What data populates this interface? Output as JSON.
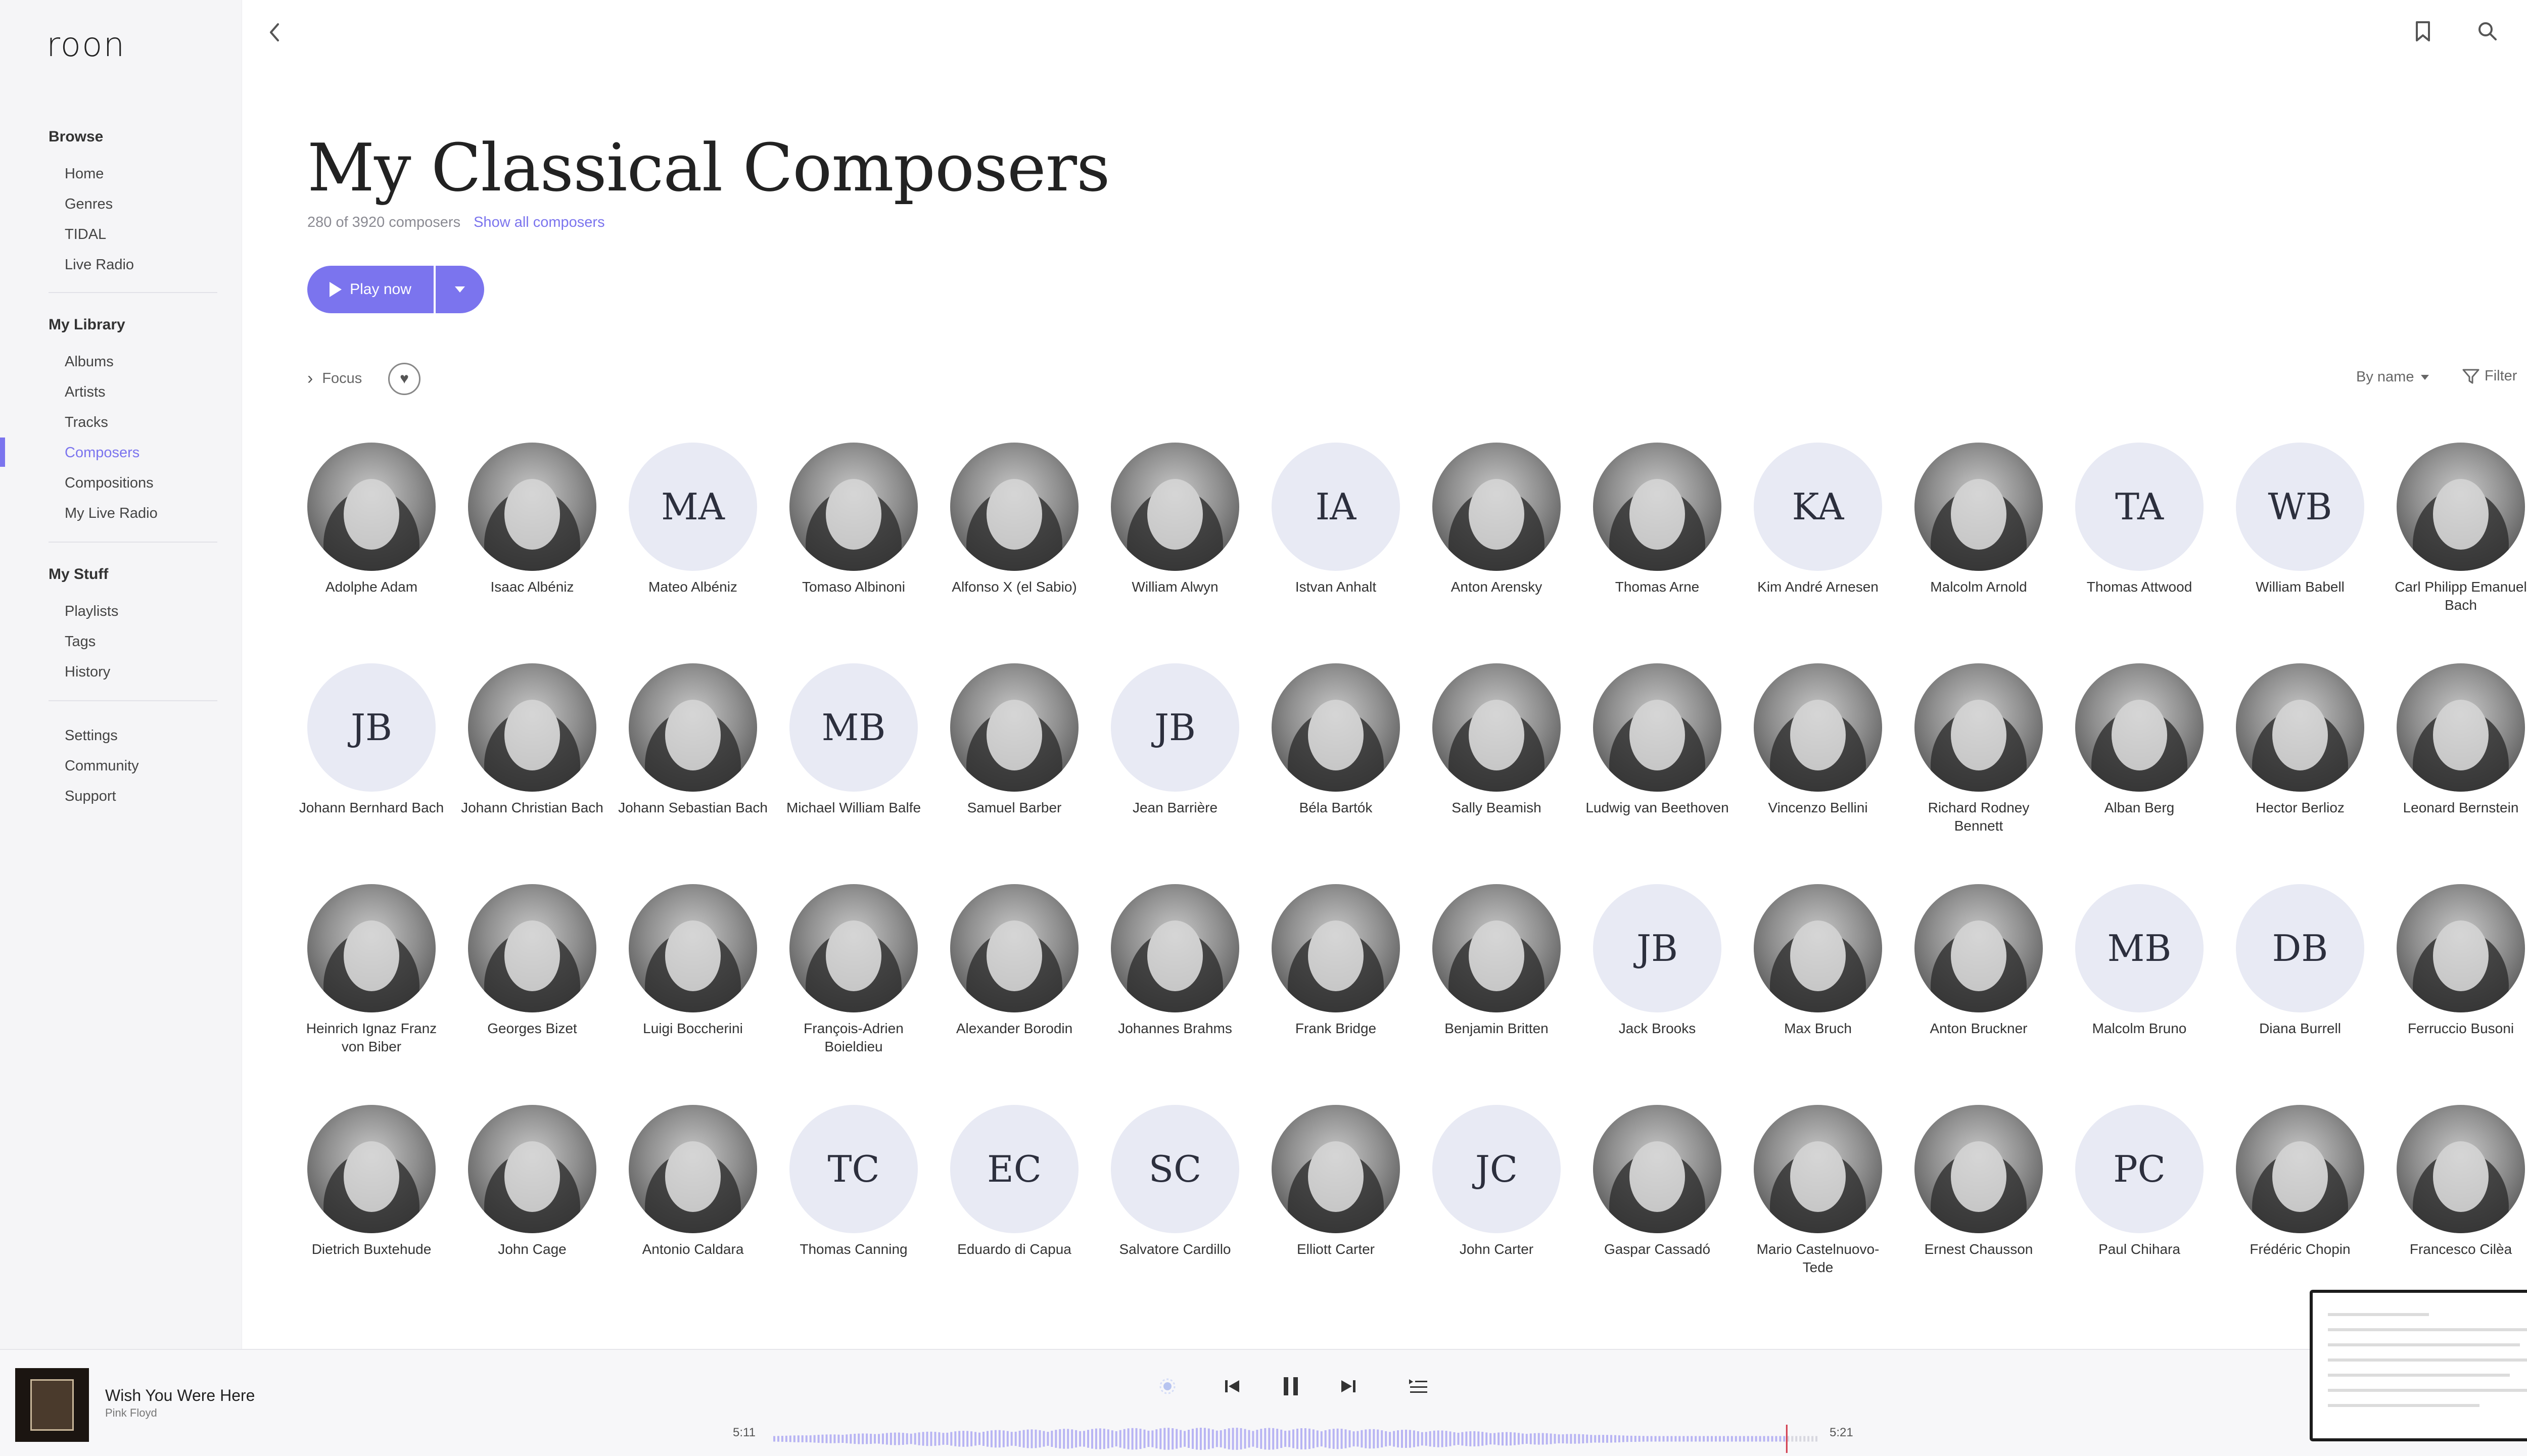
{
  "app": {
    "logo": "roon",
    "accent": "#7b74ee"
  },
  "sidebar": {
    "browse": {
      "heading": "Browse",
      "items": [
        "Home",
        "Genres",
        "TIDAL",
        "Live Radio"
      ]
    },
    "library": {
      "heading": "My Library",
      "items": [
        "Albums",
        "Artists",
        "Tracks",
        "Composers",
        "Compositions",
        "My Live Radio"
      ],
      "active": "Composers"
    },
    "stuff": {
      "heading": "My Stuff",
      "items": [
        "Playlists",
        "Tags",
        "History"
      ]
    },
    "misc": {
      "items": [
        "Settings",
        "Community",
        "Support"
      ]
    }
  },
  "topbar": {
    "icons": [
      "back-icon",
      "bookmark-icon",
      "search-icon",
      "profile-avatar"
    ]
  },
  "main": {
    "title": "My Classical Composers",
    "count_text": "280 of 3920 composers",
    "show_all": "Show all composers",
    "play_now": "Play now",
    "focus": "Focus",
    "sort": "By name",
    "filter": "Filter"
  },
  "composers": [
    {
      "name": "Adolphe Adam",
      "initials": ""
    },
    {
      "name": "Isaac Albéniz",
      "initials": ""
    },
    {
      "name": "Mateo Albéniz",
      "initials": "MA"
    },
    {
      "name": "Tomaso Albinoni",
      "initials": ""
    },
    {
      "name": "Alfonso X (el Sabio)",
      "initials": ""
    },
    {
      "name": "William Alwyn",
      "initials": ""
    },
    {
      "name": "Istvan Anhalt",
      "initials": "IA"
    },
    {
      "name": "Anton Arensky",
      "initials": ""
    },
    {
      "name": "Thomas Arne",
      "initials": ""
    },
    {
      "name": "Kim André Arnesen",
      "initials": "KA"
    },
    {
      "name": "Malcolm Arnold",
      "initials": ""
    },
    {
      "name": "Thomas Attwood",
      "initials": "TA"
    },
    {
      "name": "William Babell",
      "initials": "WB"
    },
    {
      "name": "Carl Philipp Emanuel Bach",
      "initials": ""
    },
    {
      "name": "Johann Bernhard Bach",
      "initials": "JB"
    },
    {
      "name": "Johann Christian Bach",
      "initials": ""
    },
    {
      "name": "Johann Sebastian Bach",
      "initials": ""
    },
    {
      "name": "Michael William Balfe",
      "initials": "MB"
    },
    {
      "name": "Samuel Barber",
      "initials": ""
    },
    {
      "name": "Jean Barrière",
      "initials": "JB"
    },
    {
      "name": "Béla Bartók",
      "initials": ""
    },
    {
      "name": "Sally Beamish",
      "initials": ""
    },
    {
      "name": "Ludwig van Beethoven",
      "initials": ""
    },
    {
      "name": "Vincenzo Bellini",
      "initials": ""
    },
    {
      "name": "Richard Rodney Bennett",
      "initials": ""
    },
    {
      "name": "Alban Berg",
      "initials": ""
    },
    {
      "name": "Hector Berlioz",
      "initials": ""
    },
    {
      "name": "Leonard Bernstein",
      "initials": ""
    },
    {
      "name": "Heinrich Ignaz Franz von Biber",
      "initials": ""
    },
    {
      "name": "Georges Bizet",
      "initials": ""
    },
    {
      "name": "Luigi Boccherini",
      "initials": ""
    },
    {
      "name": "François-Adrien Boieldieu",
      "initials": ""
    },
    {
      "name": "Alexander Borodin",
      "initials": ""
    },
    {
      "name": "Johannes Brahms",
      "initials": ""
    },
    {
      "name": "Frank Bridge",
      "initials": ""
    },
    {
      "name": "Benjamin Britten",
      "initials": ""
    },
    {
      "name": "Jack Brooks",
      "initials": "JB"
    },
    {
      "name": "Max Bruch",
      "initials": ""
    },
    {
      "name": "Anton Bruckner",
      "initials": ""
    },
    {
      "name": "Malcolm Bruno",
      "initials": "MB"
    },
    {
      "name": "Diana Burrell",
      "initials": "DB"
    },
    {
      "name": "Ferruccio Busoni",
      "initials": ""
    },
    {
      "name": "Dietrich Buxtehude",
      "initials": ""
    },
    {
      "name": "John Cage",
      "initials": ""
    },
    {
      "name": "Antonio Caldara",
      "initials": ""
    },
    {
      "name": "Thomas Canning",
      "initials": "TC"
    },
    {
      "name": "Eduardo di Capua",
      "initials": "EC"
    },
    {
      "name": "Salvatore Cardillo",
      "initials": "SC"
    },
    {
      "name": "Elliott Carter",
      "initials": ""
    },
    {
      "name": "John Carter",
      "initials": "JC"
    },
    {
      "name": "Gaspar Cassadó",
      "initials": ""
    },
    {
      "name": "Mario Castelnuovo-Tede",
      "initials": ""
    },
    {
      "name": "Ernest Chausson",
      "initials": ""
    },
    {
      "name": "Paul Chihara",
      "initials": "PC"
    },
    {
      "name": "Frédéric Chopin",
      "initials": ""
    },
    {
      "name": "Francesco Cilèa",
      "initials": ""
    }
  ],
  "player": {
    "title": "Wish You Were Here",
    "artist": "Pink Floyd",
    "elapsed": "5:11",
    "duration": "5:21",
    "progress": 0.968
  }
}
